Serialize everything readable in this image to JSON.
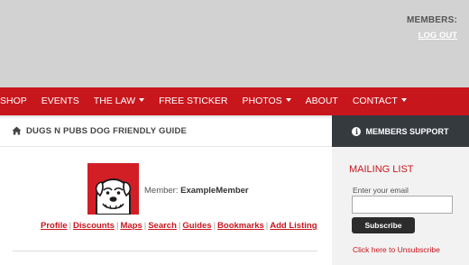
{
  "header": {
    "members_label": "MEMBERS:",
    "logout_label": "LOG OUT"
  },
  "nav": {
    "items": [
      {
        "label": "SHOP",
        "dropdown": false
      },
      {
        "label": "EVENTS",
        "dropdown": false
      },
      {
        "label": "THE LAW",
        "dropdown": true
      },
      {
        "label": "FREE STICKER",
        "dropdown": false
      },
      {
        "label": "PHOTOS",
        "dropdown": true
      },
      {
        "label": "ABOUT",
        "dropdown": false
      },
      {
        "label": "CONTACT",
        "dropdown": true
      }
    ]
  },
  "breadcrumb": {
    "icon": "home-icon",
    "title": "DUGS N PUBS DOG FRIENDLY GUIDE"
  },
  "support": {
    "icon": "info-icon",
    "label": "MEMBERS SUPPORT"
  },
  "profile": {
    "member_prefix": "Member:",
    "member_name": "ExampleMember",
    "links": [
      "Profile",
      "Discounts",
      "Maps",
      "Search",
      "Guides",
      "Bookmarks",
      "Add Listing"
    ]
  },
  "mailing": {
    "title": "MAILING LIST",
    "email_label": "Enter your email",
    "email_value": "",
    "subscribe_label": "Subscribe",
    "unsubscribe_label": "Click here to Unsubscribe"
  },
  "colors": {
    "brand_red": "#c8161d",
    "header_gray": "#d2d2d2",
    "support_dark": "#353a3f",
    "sidebar_bg": "#f2f2f2"
  }
}
